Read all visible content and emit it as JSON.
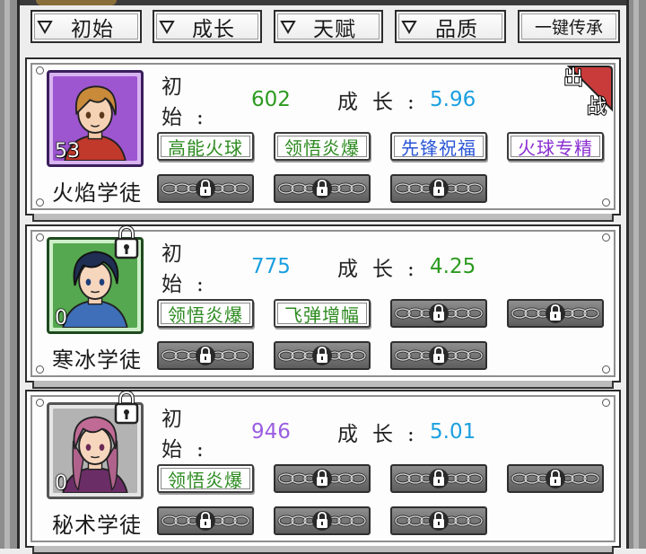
{
  "colors": {
    "green": "#2c9a1f",
    "blue": "#1b9fe0",
    "purple": "#9a5ee0",
    "skill_green": "#2c8a1f",
    "skill_blue": "#2a56d6",
    "skill_purple": "#8a2ed0",
    "deploy_red": "#c93b3b"
  },
  "filters": [
    {
      "label": "初始",
      "icon": "dropdown-triangle-icon"
    },
    {
      "label": "成长",
      "icon": "dropdown-triangle-icon"
    },
    {
      "label": "天赋",
      "icon": "dropdown-triangle-icon"
    },
    {
      "label": "品质",
      "icon": "dropdown-triangle-icon"
    }
  ],
  "inherit_button": "一键传承",
  "heroes": [
    {
      "name": "火焰学徒",
      "level": "53",
      "frame": "purple",
      "locked": false,
      "deployed": true,
      "deploy_badge": [
        "出",
        "战"
      ],
      "initial_label": "初始:",
      "initial_value": "602",
      "initial_color": "green",
      "growth_label": "成长:",
      "growth_value": "5.96",
      "growth_color": "blue",
      "skills": [
        {
          "name": "高能火球",
          "tier": "green"
        },
        {
          "name": "领悟炎爆",
          "tier": "green"
        },
        {
          "name": "先锋祝福",
          "tier": "blue"
        },
        {
          "name": "火球专精",
          "tier": "purple"
        }
      ],
      "locked_slots": 3
    },
    {
      "name": "寒冰学徒",
      "level": "0",
      "frame": "green",
      "locked": true,
      "deployed": false,
      "initial_label": "初始:",
      "initial_value": "775",
      "initial_color": "blue",
      "growth_label": "成长:",
      "growth_value": "4.25",
      "growth_color": "green",
      "skills": [
        {
          "name": "领悟炎爆",
          "tier": "green"
        },
        {
          "name": "飞弹增幅",
          "tier": "green"
        }
      ],
      "locked_slots": 5
    },
    {
      "name": "秘术学徒",
      "level": "0",
      "frame": "gray",
      "locked": true,
      "deployed": false,
      "initial_label": "初始:",
      "initial_value": "946",
      "initial_color": "purple",
      "growth_label": "成长:",
      "growth_value": "5.01",
      "growth_color": "blue",
      "skills": [
        {
          "name": "领悟炎爆",
          "tier": "green"
        }
      ],
      "locked_slots": 6
    }
  ]
}
